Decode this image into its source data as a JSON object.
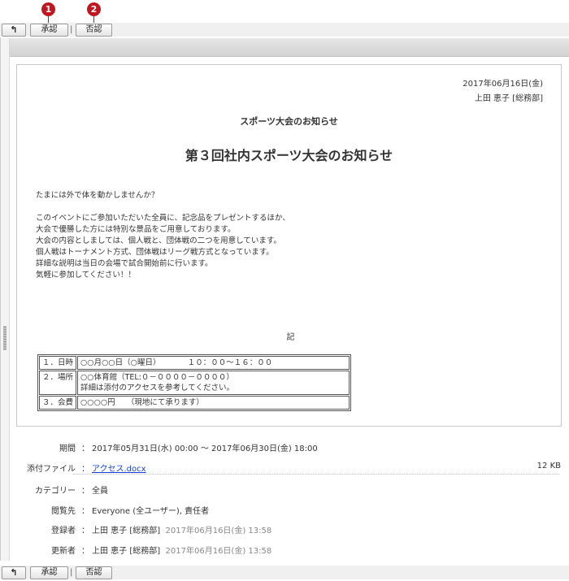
{
  "markers": {
    "m1": "1",
    "m2": "2"
  },
  "toolbar": {
    "back_icon": "back-arrow-icon",
    "approve": "承認",
    "reject": "否認",
    "separator": "|"
  },
  "document": {
    "date": "2017年06月16日(金)",
    "author": "上田 恵子 [総務部]",
    "subtitle": "スポーツ大会のお知らせ",
    "title": "第３回社内スポーツ大会のお知らせ",
    "body": [
      "たまには外で体を動かしませんか？",
      "",
      "このイベントにご参加いただいた全員に、記念品をプレゼントするほか、",
      "大会で優勝した方には特別な景品をご用意しております。",
      "大会の内容としましては、個人戦と、団体戦の二つを用意しています。",
      "個人戦はトーナメント方式、団体戦はリーグ戦方式となっています。",
      "詳細な説明は当日の会場で試合開始前に行います。",
      "気軽に参加してください！！"
    ],
    "ki": "記",
    "table": [
      {
        "label": "１．日時",
        "value": "○○月○○日（○曜日）　　　　１０：００～１６：００",
        "value2": ""
      },
      {
        "label": "２．場所",
        "value": "○○体育館（TEL:０－００００－００００）",
        "value2": "詳細は添付のアクセスを参考してください。"
      },
      {
        "label": "３．会費",
        "value": "○○○○円　　（現地にて承ります）",
        "value2": ""
      }
    ]
  },
  "meta": {
    "period_label": "期間",
    "period_value": "2017年05月31日(水) 00:00 ～ 2017年06月30日(金) 18:00",
    "attachment_label": "添付ファイル",
    "attachment_name": "アクセス.docx",
    "attachment_size": "12 KB",
    "category_label": "カテゴリー",
    "category_value": "全員",
    "viewers_label": "閲覧先",
    "viewers_value": "Everyone (全ユーザー), 責任者",
    "registrant_label": "登録者",
    "registrant_name": "上田 恵子 [総務部]",
    "registrant_date": "2017年06月16日(金) 13:58",
    "updater_label": "更新者",
    "updater_name": "上田 恵子 [総務部]",
    "updater_date": "2017年06月16日(金) 13:58",
    "colon": "："
  }
}
